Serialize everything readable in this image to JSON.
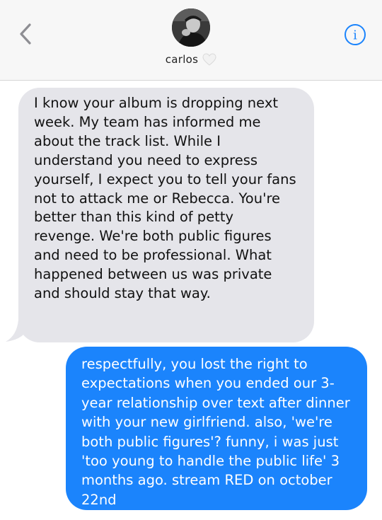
{
  "header": {
    "contact_name": "carlos",
    "back_icon": "chevron-left-icon",
    "info_icon": "info-icon",
    "heart_icon": "white-heart-icon",
    "accent_color": "#1b84fc"
  },
  "messages": [
    {
      "direction": "incoming",
      "bubble_color": "#e5e5ea",
      "text": "I know your album is dropping next\nweek. My team has informed me\nabout the track list. While I\nunderstand you need to express\nyourself, I expect you to tell your fans\nnot to attack me or Rebecca. You're\nbetter than this kind of petty\nrevenge. We're both public figures\nand need to be professional. What\nhappened between us was private\nand should stay that way."
    },
    {
      "direction": "outgoing",
      "bubble_color": "#1b84fc",
      "text": "respectfully, you lost the right to\nexpectations when you ended our 3-\nyear relationship over text after dinner\nwith your new girlfriend. also, 'we're\nboth public figures'? funny, i was just\n'too young to handle the public life' 3\nmonths ago. stream RED on october\n22nd"
    }
  ]
}
